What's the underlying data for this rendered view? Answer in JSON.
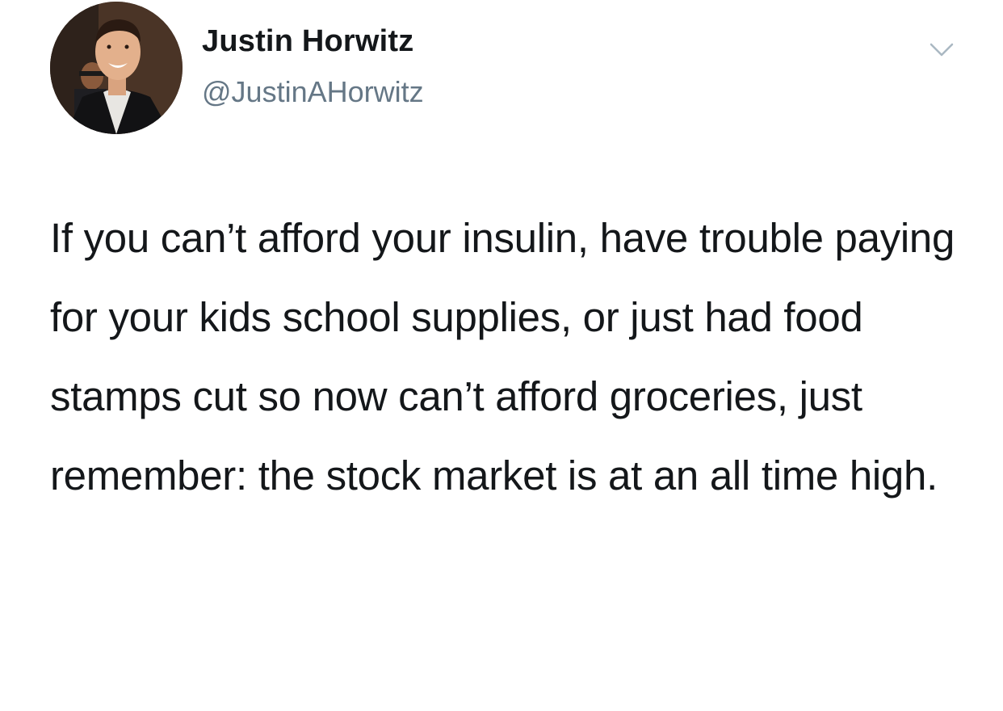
{
  "author": {
    "display_name": "Justin Horwitz",
    "handle": "@JustinAHorwitz",
    "avatar_icon": "profile-photo"
  },
  "tweet": {
    "text": "If you can’t afford your insulin, have trouble paying for your kids school supplies, or just had food stamps cut so now can’t afford groceries, just remember: the stock market is at an all time high."
  },
  "menu": {
    "icon": "chevron-down-icon"
  },
  "colors": {
    "text": "#14171a",
    "secondary_text": "#657786",
    "caret": "#aab8c2",
    "background": "#ffffff"
  }
}
